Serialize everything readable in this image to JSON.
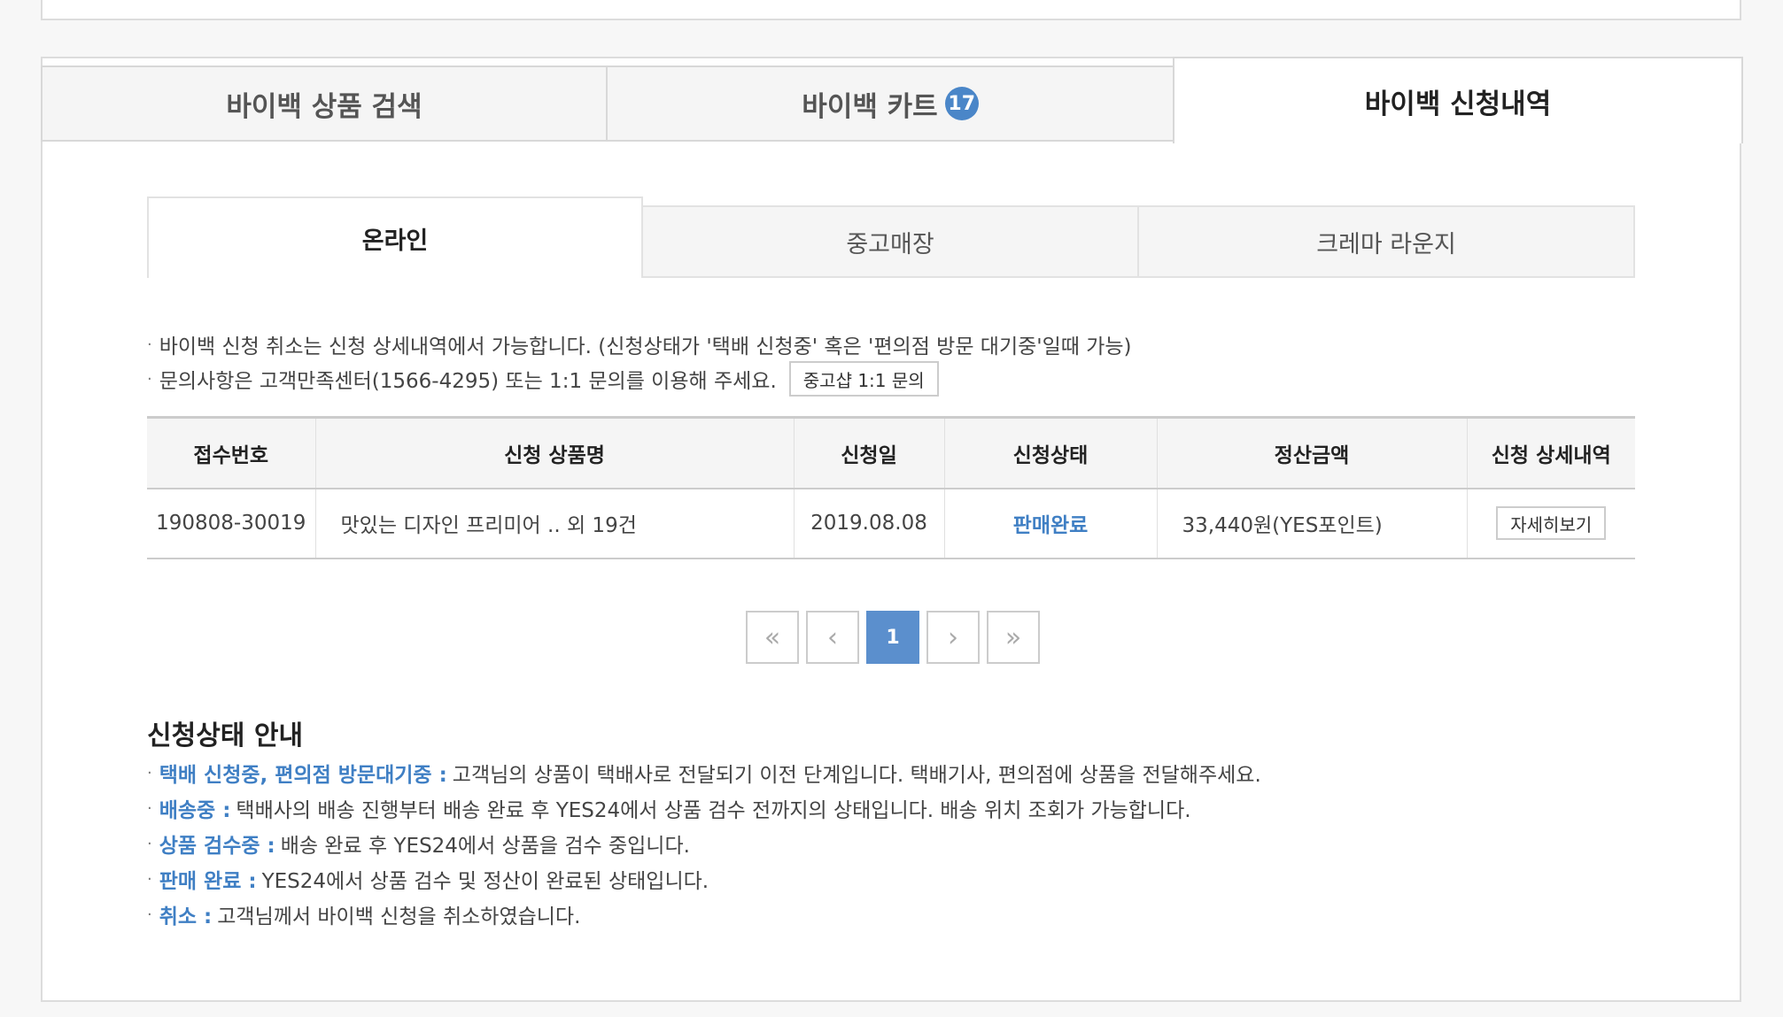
{
  "tabs": {
    "search": "바이백 상품 검색",
    "cart": "바이백 카트",
    "cart_count": "17",
    "history": "바이백 신청내역"
  },
  "subtabs": {
    "online": "온라인",
    "store": "중고매장",
    "lounge": "크레마 라운지"
  },
  "notes": {
    "line1": "바이백 신청 취소는 신청 상세내역에서 가능합니다. (신청상태가 '택배 신청중' 혹은 '편의점 방문 대기중'일때 가능)",
    "line2": "문의사항은 고객만족센터(1566-4295) 또는 1:1 문의를 이용해 주세요.",
    "inquiry_button": "중고샵 1:1 문의"
  },
  "table": {
    "headers": [
      "접수번호",
      "신청 상품명",
      "신청일",
      "신청상태",
      "정산금액",
      "신청 상세내역"
    ],
    "rows": [
      {
        "id": "190808-30019",
        "product": "맛있는 디자인 프리미어 .. 외 19건",
        "date": "2019.08.08",
        "status": "판매완료",
        "amount": "33,440원(YES포인트)",
        "detail_button": "자세히보기"
      }
    ]
  },
  "pager": {
    "first": "«",
    "prev": "‹",
    "current": "1",
    "next": "›",
    "last": "»"
  },
  "guide": {
    "title": "신청상태 안내",
    "items": [
      {
        "key": "택배 신청중, 편의점 방문대기중 :",
        "desc": "고객님의 상품이 택배사로 전달되기 이전 단계입니다. 택배기사, 편의점에 상품을 전달해주세요."
      },
      {
        "key": "배송중 :",
        "desc": "택배사의 배송 진행부터 배송 완료 후 YES24에서 상품 검수 전까지의 상태입니다. 배송 위치 조회가 가능합니다."
      },
      {
        "key": "상품 검수중 :",
        "desc": "배송 완료 후 YES24에서 상품을 검수 중입니다."
      },
      {
        "key": "판매 완료 :",
        "desc": "YES24에서 상품 검수 및 정산이 완료된 상태입니다."
      },
      {
        "key": "취소 :",
        "desc": "고객님께서 바이백 신청을 취소하였습니다."
      }
    ]
  },
  "colors": {
    "accent": "#4a86c8",
    "status_blue": "#3f7fc4"
  }
}
